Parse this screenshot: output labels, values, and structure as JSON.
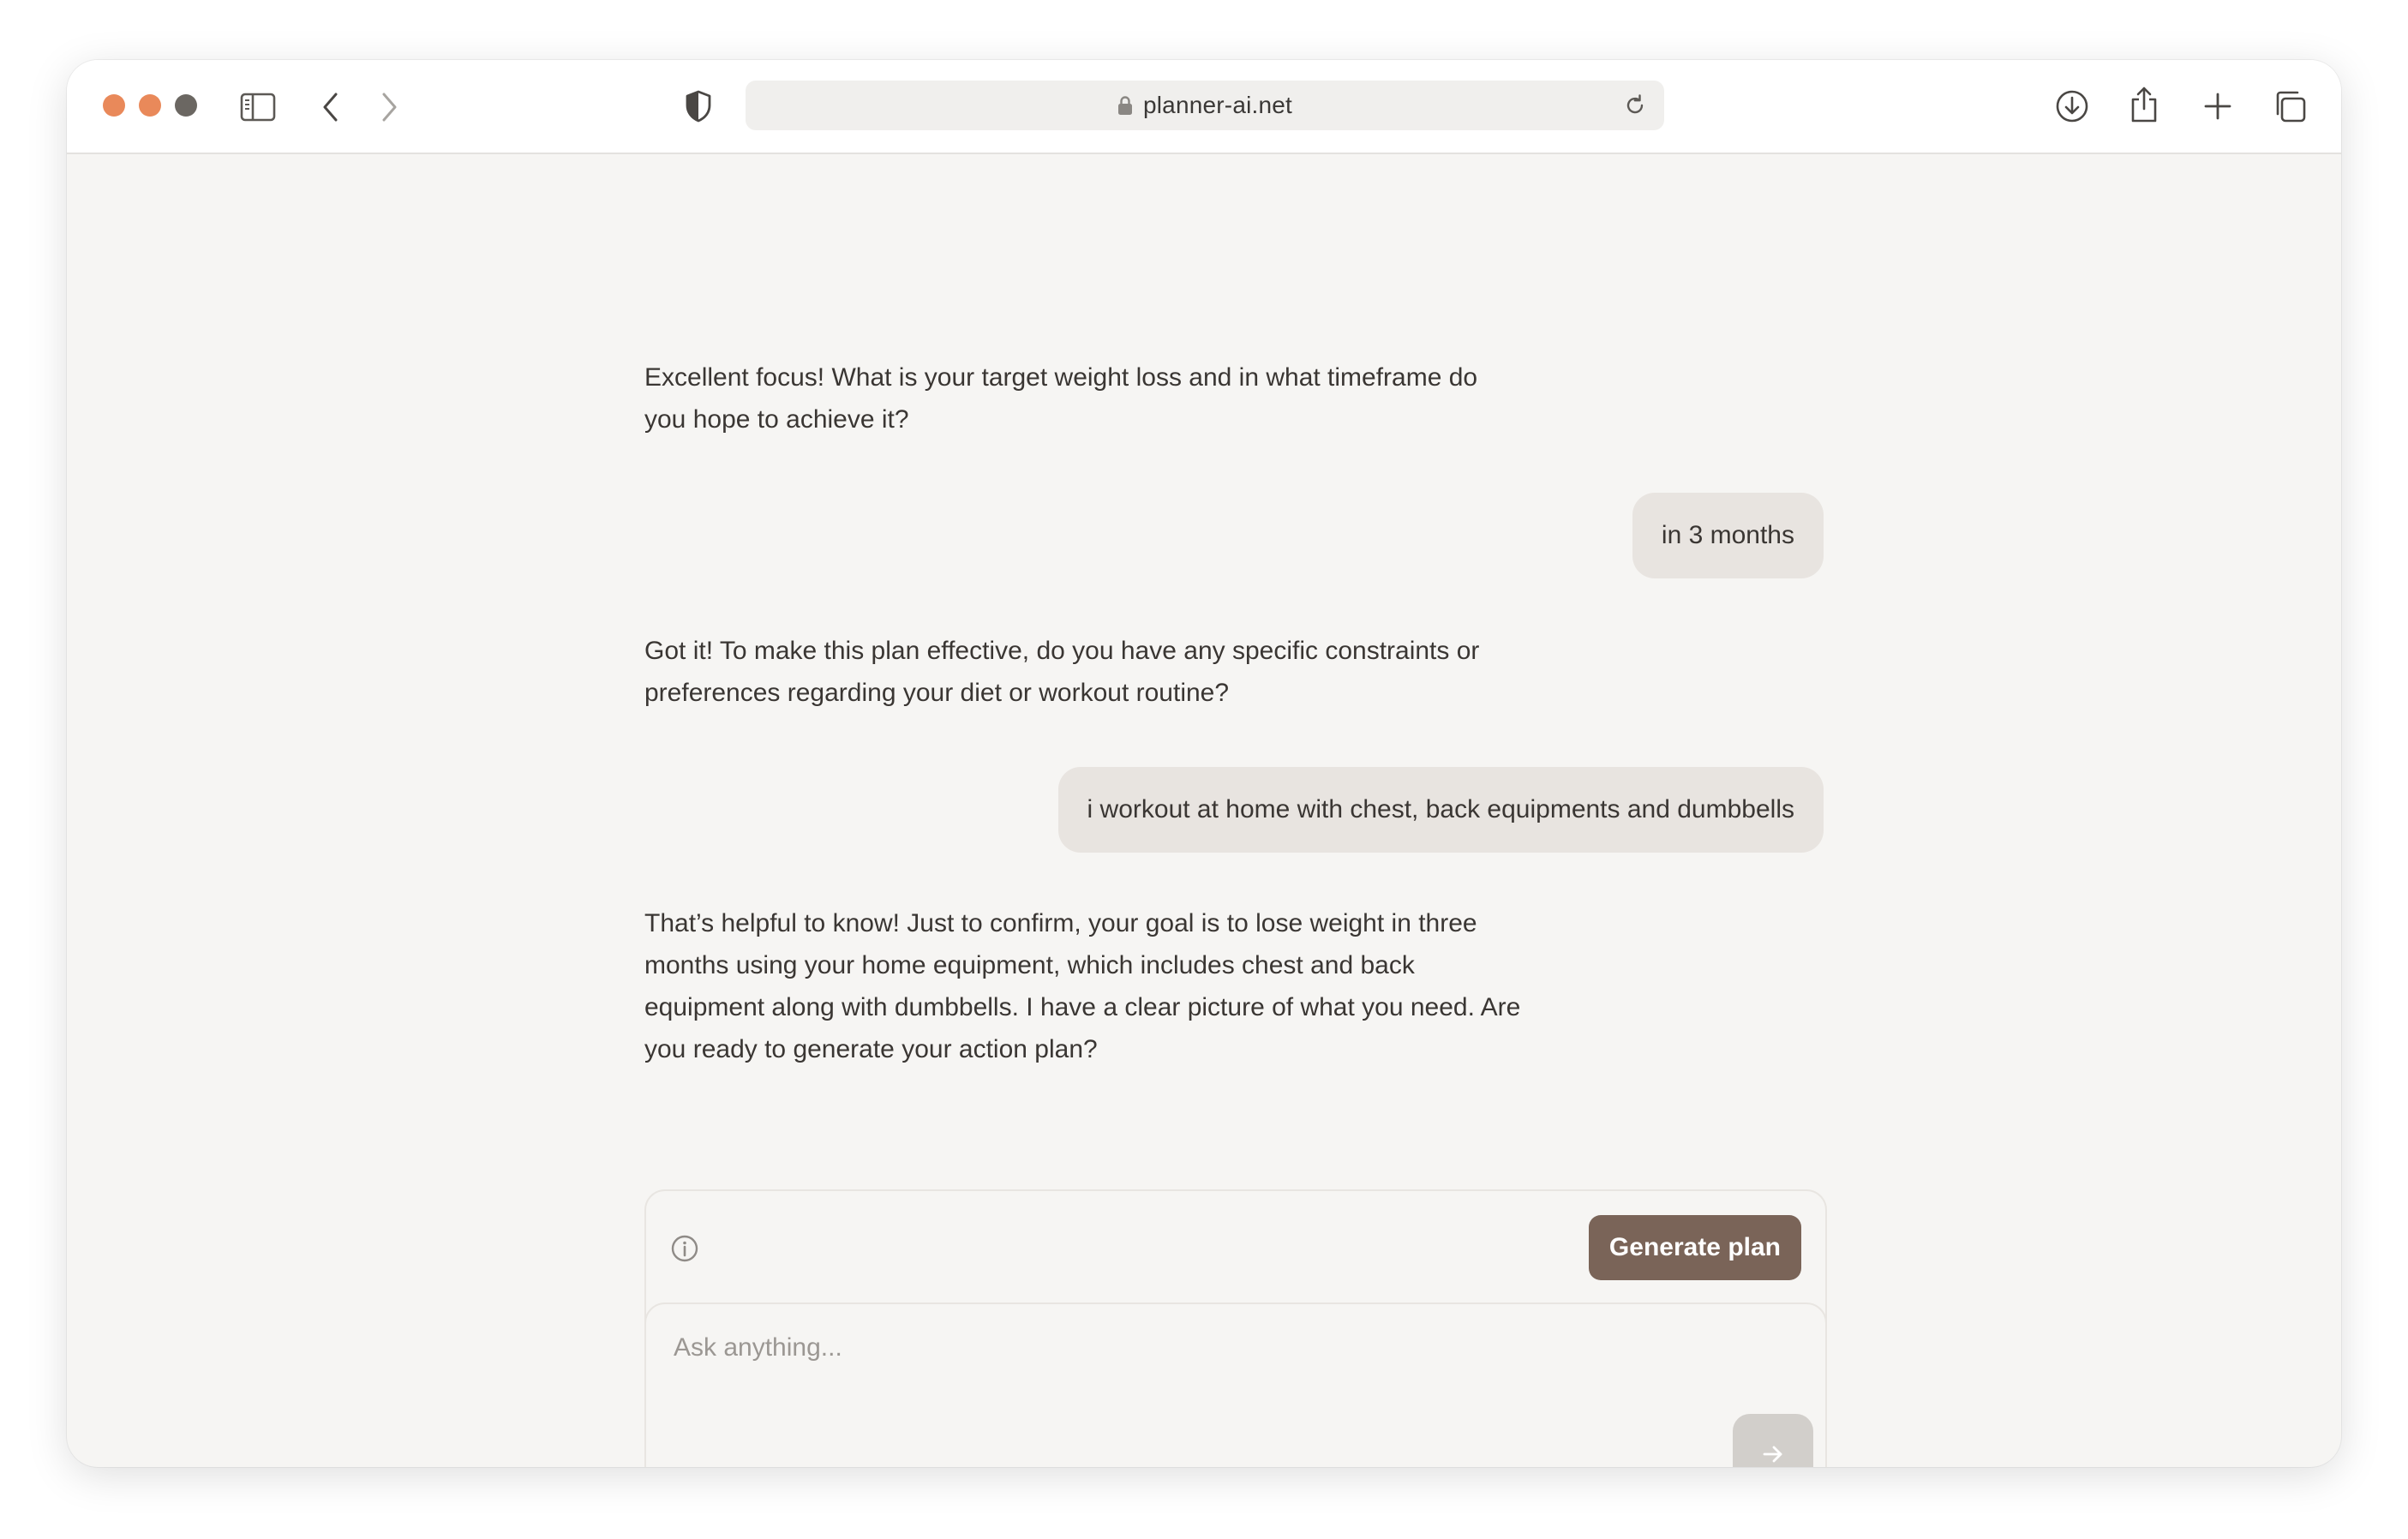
{
  "browser": {
    "url": "planner-ai.net"
  },
  "conversation": {
    "messages": [
      {
        "role": "assistant",
        "lines": [
          "Excellent focus! What is your target weight loss and in what timeframe do",
          "you hope to achieve it?"
        ]
      },
      {
        "role": "user",
        "text": "in 3 months"
      },
      {
        "role": "assistant",
        "lines": [
          "Got it! To make this plan effective, do you have any specific constraints or",
          "preferences regarding your diet or workout routine?"
        ]
      },
      {
        "role": "user",
        "text": "i workout at home with chest, back equipments and dumbbells"
      },
      {
        "role": "assistant",
        "lines": [
          "That’s helpful to know! Just to confirm, your goal is to lose weight in three",
          "months using your home equipment, which includes chest and back",
          "equipment along with dumbbells. I have a clear picture of what you need. Are",
          "you ready to generate your action plan?"
        ]
      }
    ]
  },
  "composer": {
    "generate_label": "Generate plan",
    "placeholder": "Ask anything..."
  },
  "colors": {
    "accent": "#7a6458",
    "background": "#f6f5f3",
    "user_bubble": "#e8e4e0",
    "send_disabled": "#d2cfcb"
  },
  "icons": [
    "sidebar-icon",
    "back-icon",
    "forward-icon",
    "shield-icon",
    "lock-icon",
    "reload-icon",
    "download-icon",
    "share-icon",
    "new-tab-icon",
    "tabs-overview-icon",
    "info-icon",
    "arrow-right-icon"
  ]
}
